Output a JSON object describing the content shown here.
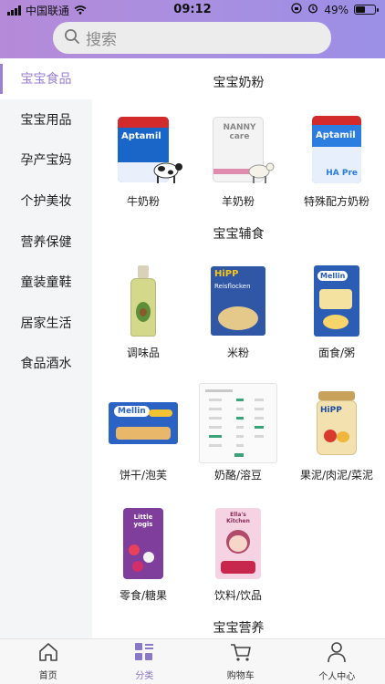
{
  "status_bar": {
    "carrier": "中国联通",
    "time": "09:12",
    "battery": "49%"
  },
  "search": {
    "placeholder": "搜索"
  },
  "sidebar": {
    "items": [
      {
        "label": "宝宝食品",
        "active": true
      },
      {
        "label": "宝宝用品"
      },
      {
        "label": "孕产宝妈"
      },
      {
        "label": "个护美妆"
      },
      {
        "label": "营养保健"
      },
      {
        "label": "童装童鞋"
      },
      {
        "label": "居家生活"
      },
      {
        "label": "食品酒水"
      }
    ]
  },
  "sections": [
    {
      "title": "宝宝奶粉",
      "items": [
        {
          "label": "牛奶粉",
          "brand": "Aptamil"
        },
        {
          "label": "羊奶粉",
          "brand": "NANNY care"
        },
        {
          "label": "特殊配方奶粉",
          "brand": "Aptamil",
          "sub": "HA Pre"
        }
      ]
    },
    {
      "title": "宝宝辅食",
      "items": [
        {
          "label": "调味品"
        },
        {
          "label": "米粉",
          "brand": "HiPP",
          "sub": "Reisflocken"
        },
        {
          "label": "面食/粥",
          "brand": "Mellin"
        },
        {
          "label": "饼干/泡芙",
          "brand": "Mellin"
        },
        {
          "label": "奶酪/溶豆"
        },
        {
          "label": "果泥/肉泥/菜泥",
          "brand": "HiPP"
        },
        {
          "label": "零食/糖果",
          "brand": "Little yogis"
        },
        {
          "label": "饮料/饮品",
          "brand": "Ella's Kitchen"
        }
      ]
    },
    {
      "title": "宝宝营养"
    }
  ],
  "tabbar": {
    "items": [
      {
        "label": "首页",
        "icon": "home-icon"
      },
      {
        "label": "分类",
        "icon": "category-icon",
        "active": true
      },
      {
        "label": "购物车",
        "icon": "cart-icon"
      },
      {
        "label": "个人中心",
        "icon": "user-icon"
      }
    ]
  },
  "colors": {
    "accent": "#9b7fd4",
    "header_gradient_start": "#b58ad8",
    "header_gradient_end": "#9b8fe6"
  }
}
